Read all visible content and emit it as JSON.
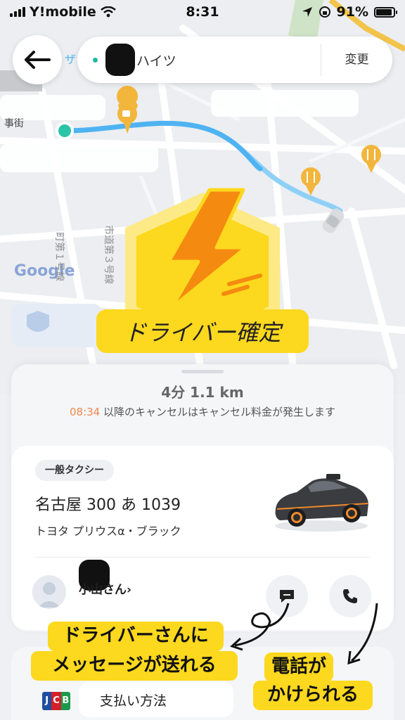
{
  "status_bar": {
    "carrier": "Y!mobile",
    "time": "8:31",
    "battery": "91%",
    "battery_level": 0.91
  },
  "map": {
    "poi_fragment": "ザ",
    "street_fragment": "事街",
    "attribution": "Google",
    "street_label_1": "町第１号線",
    "street_label_2": "市道第３号線",
    "colors": {
      "route": "#4fb3f2",
      "poi": "#f2b63d"
    }
  },
  "header": {
    "destination": "ハイツ",
    "change_label": "変更"
  },
  "badge": {
    "label": "ドライバー確定",
    "colors": {
      "bolt": "#f58a10",
      "hex": "#fcd81e"
    }
  },
  "trip": {
    "eta": "4分 1.1 km",
    "cancel_time": "08:34",
    "cancel_text": "以降のキャンセルはキャンセル料金が発生します"
  },
  "driver": {
    "car_type": "一般タクシー",
    "plate": "名古屋 300 あ 1039",
    "model": "トヨタ プリウスα・ブラック",
    "name": "小山さん›"
  },
  "payment": {
    "card_brand": [
      "J",
      "C",
      "B"
    ],
    "label": "支払い方法"
  },
  "annotations": {
    "message_note": [
      "ドライバーさんに",
      "メッセージが送れる"
    ],
    "call_note": [
      "電話が",
      "かけられる"
    ]
  }
}
